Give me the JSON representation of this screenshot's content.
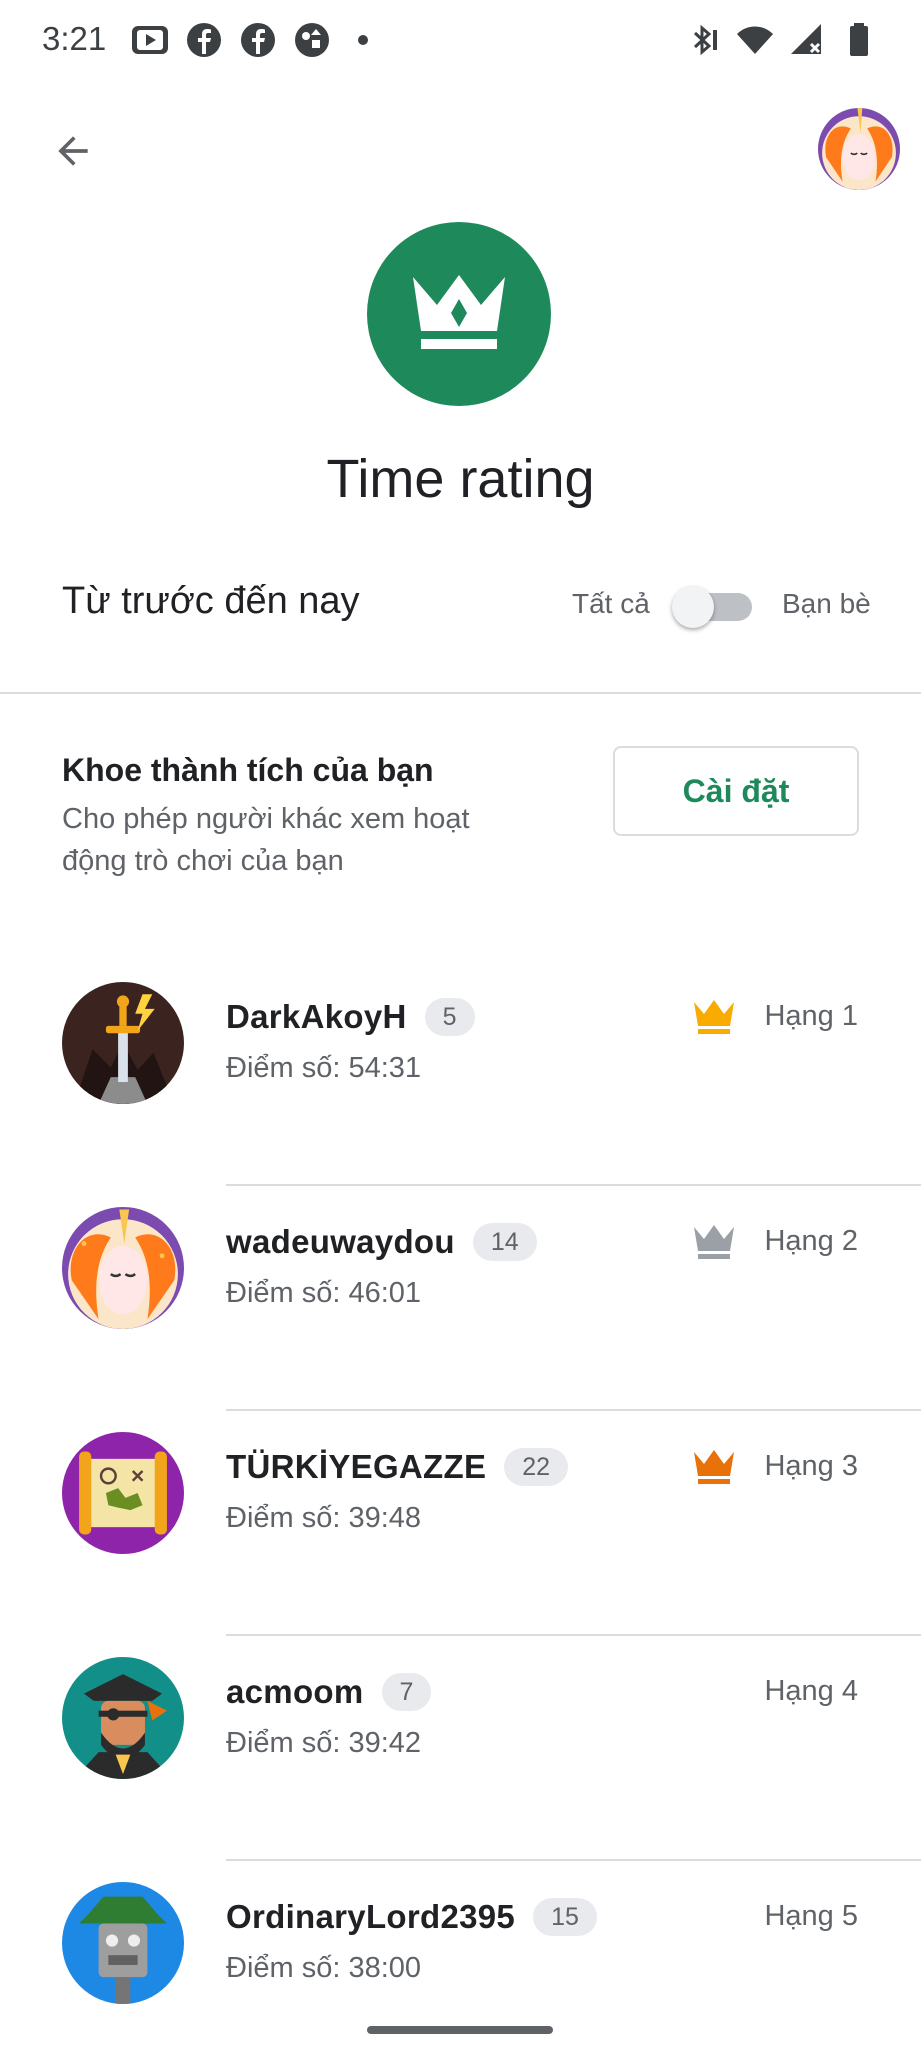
{
  "status_bar": {
    "time": "3:21",
    "left_icons": [
      "youtube-icon",
      "facebook-icon",
      "facebook-icon",
      "games-icon",
      "dot-icon"
    ],
    "right_icons": [
      "bluetooth-icon",
      "wifi-icon",
      "no-signal-icon",
      "battery-icon"
    ]
  },
  "header": {
    "back_icon": "arrow-back-icon",
    "title": "Time rating",
    "hero_icon": "crown-icon",
    "hero_color": "#1e8a5c"
  },
  "filter": {
    "period_label": "Từ trước đến nay",
    "all_label": "Tất cả",
    "friends_label": "Bạn bè",
    "toggle_on": false
  },
  "share_card": {
    "title": "Khoe thành tích của bạn",
    "description": "Cho phép người khác xem hoạt động trò chơi của bạn",
    "button_label": "Cài đặt"
  },
  "leaderboard": [
    {
      "name": "DarkAkoyH",
      "level": "5",
      "score": "Điểm số: 54:31",
      "rank": "Hạng 1",
      "crown": "gold",
      "crown_color": "#f9ab00"
    },
    {
      "name": "wadeuwaydou",
      "level": "14",
      "score": "Điểm số: 46:01",
      "rank": "Hạng 2",
      "crown": "silver",
      "crown_color": "#9aa0a6"
    },
    {
      "name": "TÜRKİYEGAZZE",
      "level": "22",
      "score": "Điểm số: 39:48",
      "rank": "Hạng 3",
      "crown": "bronze",
      "crown_color": "#e8710a"
    },
    {
      "name": "acmoom",
      "level": "7",
      "score": "Điểm số: 39:42",
      "rank": "Hạng 4",
      "crown": "none"
    },
    {
      "name": "OrdinaryLord2395",
      "level": "15",
      "score": "Điểm số: 38:00",
      "rank": "Hạng 5",
      "crown": "none"
    }
  ]
}
